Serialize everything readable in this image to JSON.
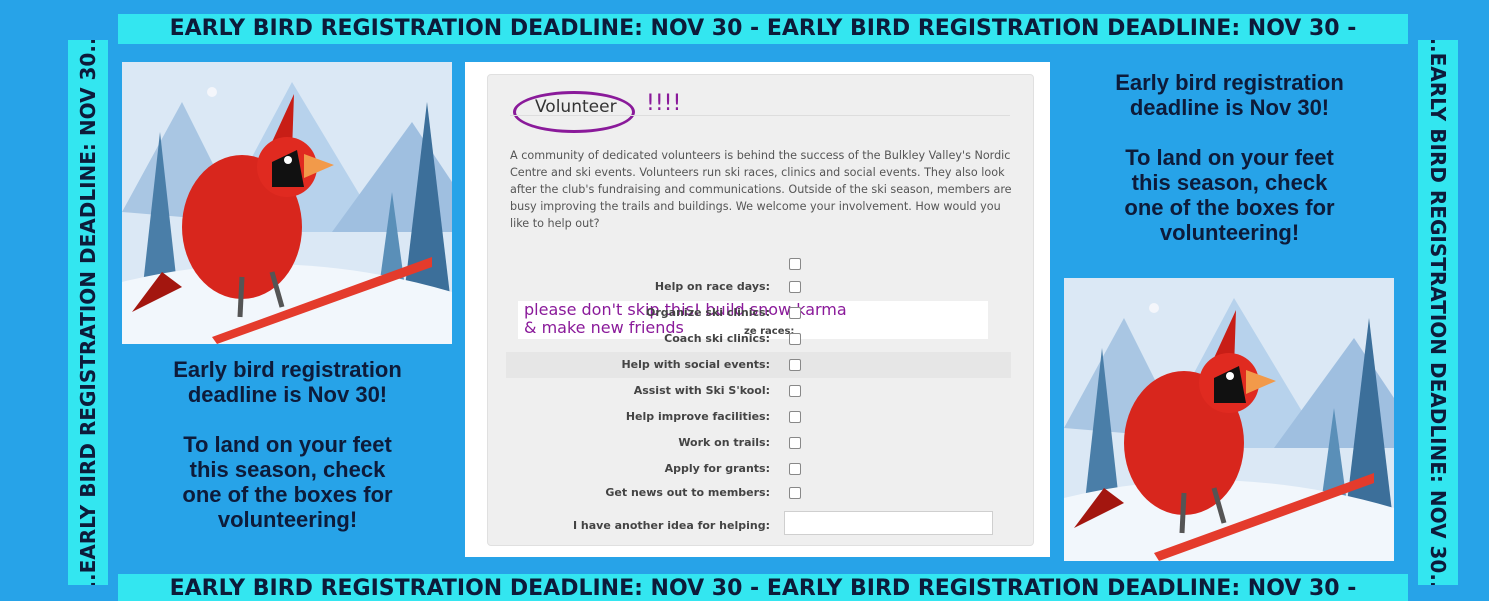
{
  "banners": {
    "top": "EARLY BIRD REGISTRATION DEADLINE: NOV 30 - EARLY BIRD REGISTRATION DEADLINE: NOV 30 -",
    "bottom": "EARLY BIRD REGISTRATION DEADLINE: NOV 30 - EARLY BIRD REGISTRATION DEADLINE: NOV 30 -",
    "left": "...EARLY BIRD REGISTRATION DEADLINE: NOV 30...",
    "right": "...EARLY BIRD REGISTRATION DEADLINE: NOV 30..."
  },
  "promo": {
    "line1": "Early bird registration",
    "line2": "deadline is Nov 30!",
    "line3": "To land on your feet",
    "line4": "this season, check",
    "line5": "one of the boxes for",
    "line6": "volunteering!"
  },
  "form": {
    "title": "Volunteer",
    "exclamation": "!!!!",
    "description": "A community of dedicated volunteers is behind the success of the Bulkley Valley's Nordic Centre and ski events. Volunteers run ski races, clinics and social events. They also look after the club's fundraising and communications. Outside of the ski season, members are busy improving the trails and buildings. We welcome your involvement. How would you like to help out?",
    "note_line1": "please don't skip this! build snow karma",
    "note_line2": "& make new friends",
    "note_cut_label": "ze races:",
    "options": [
      "Help on race days:",
      "Organize ski clinics:",
      "Coach ski clinics:",
      "Help with social events:",
      "Assist with Ski S'kool:",
      "Help improve facilities:",
      "Work on trails:",
      "Apply for grants:",
      "Get news out to members:"
    ],
    "idea_label": "I have another idea for helping:"
  },
  "colors": {
    "background": "#27a3e8",
    "banner": "#33e6f0",
    "annotation": "#8a1a9a",
    "text_dark": "#0d1b3a"
  }
}
